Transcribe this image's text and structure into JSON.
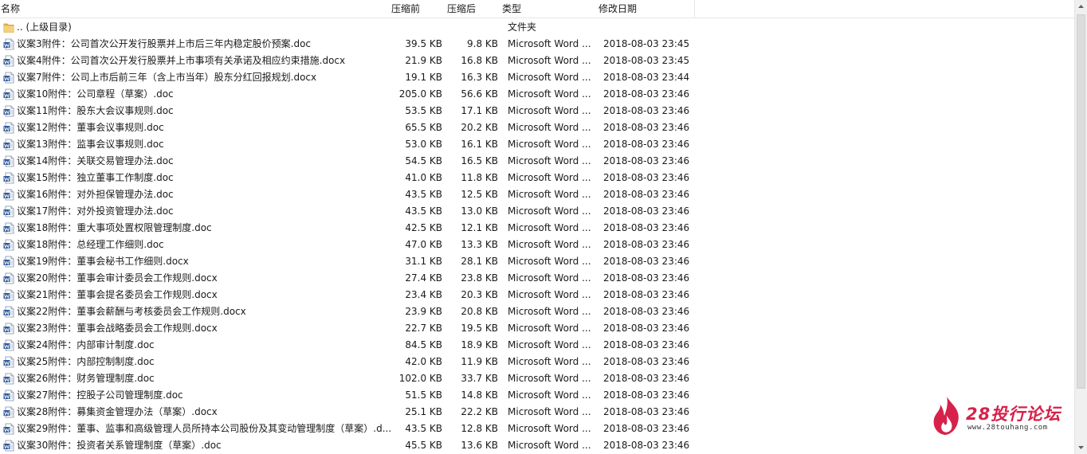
{
  "columns": {
    "name": "名称",
    "before": "压缩前",
    "after": "压缩后",
    "type": "类型",
    "modified": "修改日期"
  },
  "parent_row": {
    "name": ".. (上级目录)",
    "type": "文件夹",
    "icon": "folder-icon"
  },
  "files": [
    {
      "name": "议案3附件：公司首次公开发行股票并上市后三年内稳定股价预案.doc",
      "before": "39.5 KB",
      "after": "9.8 KB",
      "type": "Microsoft Word ...",
      "date": "2018-08-03 23:45"
    },
    {
      "name": "议案4附件：公司首次公开发行股票并上市事项有关承诺及相应约束措施.docx",
      "before": "21.9 KB",
      "after": "16.8 KB",
      "type": "Microsoft Word ...",
      "date": "2018-08-03 23:45"
    },
    {
      "name": "议案7附件：公司上市后前三年（含上市当年）股东分红回报规划.docx",
      "before": "19.1 KB",
      "after": "16.3 KB",
      "type": "Microsoft Word ...",
      "date": "2018-08-03 23:44"
    },
    {
      "name": "议案10附件：公司章程（草案）.doc",
      "before": "205.0 KB",
      "after": "56.6 KB",
      "type": "Microsoft Word ...",
      "date": "2018-08-03 23:46"
    },
    {
      "name": "议案11附件：股东大会议事规则.doc",
      "before": "53.5 KB",
      "after": "17.1 KB",
      "type": "Microsoft Word ...",
      "date": "2018-08-03 23:46"
    },
    {
      "name": "议案12附件：董事会议事规则.doc",
      "before": "65.5 KB",
      "after": "20.2 KB",
      "type": "Microsoft Word ...",
      "date": "2018-08-03 23:46"
    },
    {
      "name": "议案13附件：监事会议事规则.doc",
      "before": "53.0 KB",
      "after": "16.1 KB",
      "type": "Microsoft Word ...",
      "date": "2018-08-03 23:46"
    },
    {
      "name": "议案14附件：关联交易管理办法.doc",
      "before": "54.5 KB",
      "after": "16.5 KB",
      "type": "Microsoft Word ...",
      "date": "2018-08-03 23:46"
    },
    {
      "name": "议案15附件：独立董事工作制度.doc",
      "before": "41.0 KB",
      "after": "11.8 KB",
      "type": "Microsoft Word ...",
      "date": "2018-08-03 23:46"
    },
    {
      "name": "议案16附件：对外担保管理办法.doc",
      "before": "43.5 KB",
      "after": "12.5 KB",
      "type": "Microsoft Word ...",
      "date": "2018-08-03 23:46"
    },
    {
      "name": "议案17附件：对外投资管理办法.doc",
      "before": "43.5 KB",
      "after": "13.0 KB",
      "type": "Microsoft Word ...",
      "date": "2018-08-03 23:46"
    },
    {
      "name": "议案18附件：重大事项处置权限管理制度.doc",
      "before": "42.5 KB",
      "after": "12.1 KB",
      "type": "Microsoft Word ...",
      "date": "2018-08-03 23:46"
    },
    {
      "name": "议案18附件：总经理工作细则.doc",
      "before": "47.0 KB",
      "after": "13.3 KB",
      "type": "Microsoft Word ...",
      "date": "2018-08-03 23:46"
    },
    {
      "name": "议案19附件：董事会秘书工作细则.docx",
      "before": "31.1 KB",
      "after": "28.1 KB",
      "type": "Microsoft Word ...",
      "date": "2018-08-03 23:46"
    },
    {
      "name": "议案20附件：董事会审计委员会工作规则.docx",
      "before": "27.4 KB",
      "after": "23.8 KB",
      "type": "Microsoft Word ...",
      "date": "2018-08-03 23:46"
    },
    {
      "name": "议案21附件：董事会提名委员会工作规则.docx",
      "before": "23.4 KB",
      "after": "20.3 KB",
      "type": "Microsoft Word ...",
      "date": "2018-08-03 23:46"
    },
    {
      "name": "议案22附件：董事会薪酬与考核委员会工作规则.docx",
      "before": "23.9 KB",
      "after": "20.8 KB",
      "type": "Microsoft Word ...",
      "date": "2018-08-03 23:46"
    },
    {
      "name": "议案23附件：董事会战略委员会工作规则.docx",
      "before": "22.7 KB",
      "after": "19.5 KB",
      "type": "Microsoft Word ...",
      "date": "2018-08-03 23:46"
    },
    {
      "name": "议案24附件：内部审计制度.doc",
      "before": "84.5 KB",
      "after": "18.9 KB",
      "type": "Microsoft Word ...",
      "date": "2018-08-03 23:46"
    },
    {
      "name": "议案25附件：内部控制制度.doc",
      "before": "42.0 KB",
      "after": "11.9 KB",
      "type": "Microsoft Word ...",
      "date": "2018-08-03 23:46"
    },
    {
      "name": "议案26附件：财务管理制度.doc",
      "before": "102.0 KB",
      "after": "33.7 KB",
      "type": "Microsoft Word ...",
      "date": "2018-08-03 23:46"
    },
    {
      "name": "议案27附件：控股子公司管理制度.doc",
      "before": "51.5 KB",
      "after": "14.8 KB",
      "type": "Microsoft Word ...",
      "date": "2018-08-03 23:46"
    },
    {
      "name": "议案28附件：募集资金管理办法（草案）.docx",
      "before": "25.1 KB",
      "after": "22.2 KB",
      "type": "Microsoft Word ...",
      "date": "2018-08-03 23:46"
    },
    {
      "name": "议案29附件：董事、监事和高级管理人员所持本公司股份及其变动管理制度（草案）.d...",
      "before": "43.5 KB",
      "after": "12.8 KB",
      "type": "Microsoft Word ...",
      "date": "2018-08-03 23:46"
    },
    {
      "name": "议案30附件：投资者关系管理制度（草案）.doc",
      "before": "45.5 KB",
      "after": "13.6 KB",
      "type": "Microsoft Word ...",
      "date": "2018-08-03 23:46"
    }
  ],
  "file_icon": "word-doc-icon",
  "watermark": {
    "brand": "28投行论坛",
    "url": "www.28touhang.com",
    "icon": "flame-logo-icon",
    "color": "#d6224a"
  }
}
